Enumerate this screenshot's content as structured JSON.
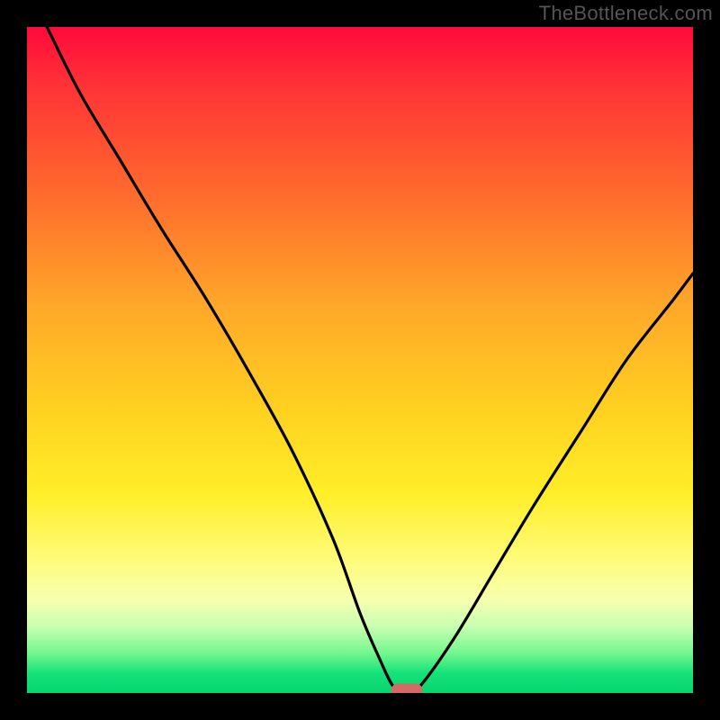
{
  "watermark_text": "TheBottleneck.com",
  "chart_data": {
    "type": "line",
    "title": "",
    "xlabel": "",
    "ylabel": "",
    "xlim": [
      0,
      100
    ],
    "ylim": [
      0,
      100
    ],
    "notes": "V-shaped bottleneck curve over a vertical red→yellow→green gradient background. y = bottleneck percentage (0 at bottom/green, 100 at top/red). Minimum at the small rounded marker.",
    "background_gradient_stops": [
      {
        "pos": 0,
        "color": "#ff0a3a"
      },
      {
        "pos": 8,
        "color": "#ff2f37"
      },
      {
        "pos": 25,
        "color": "#ff6a2e"
      },
      {
        "pos": 42,
        "color": "#ffa829"
      },
      {
        "pos": 58,
        "color": "#ffd220"
      },
      {
        "pos": 70,
        "color": "#ffee28"
      },
      {
        "pos": 80,
        "color": "#fffb7a"
      },
      {
        "pos": 86,
        "color": "#f6ffb0"
      },
      {
        "pos": 90,
        "color": "#c8ffb0"
      },
      {
        "pos": 94,
        "color": "#74f78e"
      },
      {
        "pos": 97,
        "color": "#16e27a"
      },
      {
        "pos": 100,
        "color": "#06d46e"
      }
    ],
    "series": [
      {
        "name": "bottleneck-curve",
        "x": [
          3,
          8,
          14,
          20,
          27,
          34,
          40,
          46,
          50,
          53,
          55,
          57,
          59,
          64,
          70,
          76,
          83,
          90,
          97,
          100
        ],
        "y": [
          100,
          90,
          80,
          70,
          59,
          47,
          36,
          23,
          12,
          5,
          1,
          0,
          1,
          8,
          18,
          28,
          39,
          50,
          59,
          63
        ]
      }
    ],
    "marker": {
      "x": 57,
      "y": 0,
      "color": "#d46a65"
    }
  }
}
